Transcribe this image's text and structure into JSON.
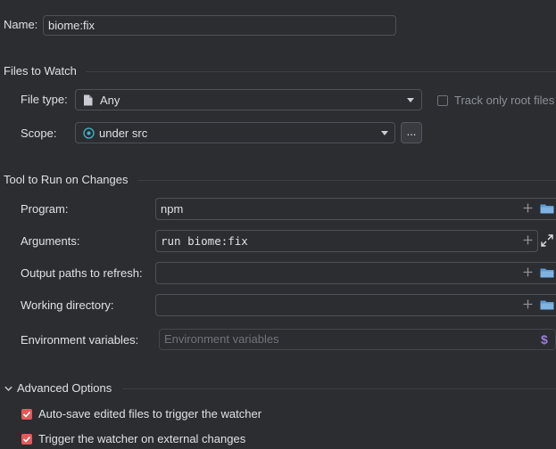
{
  "name": {
    "label": "Name:",
    "value": "biome:fix"
  },
  "files_to_watch": {
    "title": "Files to Watch",
    "file_type": {
      "label": "File type:",
      "value": "Any"
    },
    "track_root": {
      "label": "Track only root files",
      "checked": false
    },
    "scope": {
      "label": "Scope:",
      "value": "under src",
      "browse_label": "..."
    }
  },
  "tool": {
    "title": "Tool to Run on Changes",
    "program": {
      "label": "Program:",
      "value": "npm"
    },
    "arguments": {
      "label": "Arguments:",
      "value": "run biome:fix"
    },
    "output_paths": {
      "label": "Output paths to refresh:",
      "value": ""
    },
    "working_dir": {
      "label": "Working directory:",
      "value": ""
    },
    "env_vars": {
      "label": "Environment variables:",
      "placeholder": "Environment variables",
      "symbol": "$"
    }
  },
  "advanced": {
    "title": "Advanced Options",
    "expanded": true,
    "options": [
      {
        "label": "Auto-save edited files to trigger the watcher",
        "checked": true
      },
      {
        "label": "Trigger the watcher on external changes",
        "checked": true
      }
    ]
  },
  "colors": {
    "background": "#2b2d30",
    "border": "#4e5157",
    "text": "#dfe1e5",
    "placeholder": "#6f737a",
    "checkbox_checked": "#e05a5a",
    "scope_icon": "#3fb5c7",
    "env_symbol": "#9b7fe0",
    "folder_icon": "#5b9bd5"
  }
}
